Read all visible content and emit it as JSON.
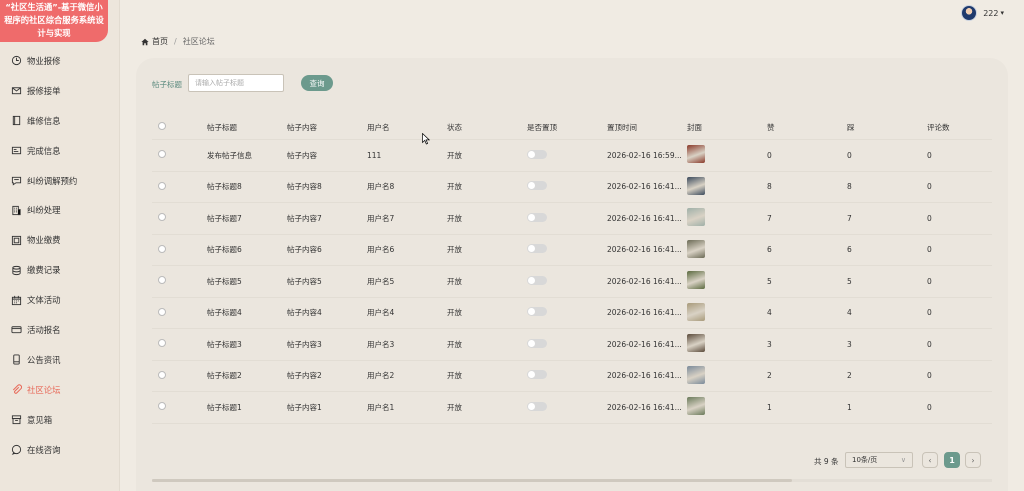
{
  "brand": {
    "title": "“社区生活通”-基于微信小程序的社区综合服务系统设计与实现"
  },
  "sidebar": {
    "items": [
      {
        "label": "物业报修",
        "icon": "clock-icon",
        "active": false
      },
      {
        "label": "报修接单",
        "icon": "mail-icon",
        "active": false
      },
      {
        "label": "维修信息",
        "icon": "book-icon",
        "active": false
      },
      {
        "label": "完成信息",
        "icon": "card-icon",
        "active": false
      },
      {
        "label": "纠纷调解预约",
        "icon": "chat-icon",
        "active": false
      },
      {
        "label": "纠纷处理",
        "icon": "building-icon",
        "active": false
      },
      {
        "label": "物业缴费",
        "icon": "grid-icon",
        "active": false
      },
      {
        "label": "缴费记录",
        "icon": "database-icon",
        "active": false
      },
      {
        "label": "文体活动",
        "icon": "calendar-icon",
        "active": false
      },
      {
        "label": "活动报名",
        "icon": "ticket-icon",
        "active": false
      },
      {
        "label": "公告资讯",
        "icon": "phone-icon",
        "active": false
      },
      {
        "label": "社区论坛",
        "icon": "paperclip-icon",
        "active": true
      },
      {
        "label": "意见箱",
        "icon": "box-icon",
        "active": false
      },
      {
        "label": "在线咨询",
        "icon": "bubble-icon",
        "active": false
      }
    ]
  },
  "header": {
    "username": "222"
  },
  "breadcrumb": {
    "home": "首页",
    "current": "社区论坛"
  },
  "search": {
    "label": "帖子标题",
    "placeholder": "请输入帖子标题",
    "button": "查询"
  },
  "table": {
    "columns": [
      "",
      "帖子标题",
      "帖子内容",
      "用户名",
      "状态",
      "是否置顶",
      "置顶时间",
      "封面",
      "赞",
      "踩",
      "评论数"
    ],
    "rows": [
      {
        "title": "发布帖子信息",
        "content": "帖子内容",
        "user": "111",
        "status": "开放",
        "top_time": "2026-02-16 16:59...",
        "like": "0",
        "dislike": "0",
        "comments": "0",
        "cover": "#8a3a2a"
      },
      {
        "title": "帖子标题8",
        "content": "帖子内容8",
        "user": "用户名8",
        "status": "开放",
        "top_time": "2026-02-16 16:41...",
        "like": "8",
        "dislike": "8",
        "comments": "0",
        "cover": "#3b4a5c"
      },
      {
        "title": "帖子标题7",
        "content": "帖子内容7",
        "user": "用户名7",
        "status": "开放",
        "top_time": "2026-02-16 16:41...",
        "like": "7",
        "dislike": "7",
        "comments": "0",
        "cover": "#9fb0a8"
      },
      {
        "title": "帖子标题6",
        "content": "帖子内容6",
        "user": "用户名6",
        "status": "开放",
        "top_time": "2026-02-16 16:41...",
        "like": "6",
        "dislike": "6",
        "comments": "0",
        "cover": "#6b6a55"
      },
      {
        "title": "帖子标题5",
        "content": "帖子内容5",
        "user": "用户名5",
        "status": "开放",
        "top_time": "2026-02-16 16:41...",
        "like": "5",
        "dislike": "5",
        "comments": "0",
        "cover": "#5b6a3f"
      },
      {
        "title": "帖子标题4",
        "content": "帖子内容4",
        "user": "用户名4",
        "status": "开放",
        "top_time": "2026-02-16 16:41...",
        "like": "4",
        "dislike": "4",
        "comments": "0",
        "cover": "#a89a7a"
      },
      {
        "title": "帖子标题3",
        "content": "帖子内容3",
        "user": "用户名3",
        "status": "开放",
        "top_time": "2026-02-16 16:41...",
        "like": "3",
        "dislike": "3",
        "comments": "0",
        "cover": "#5a4a3a"
      },
      {
        "title": "帖子标题2",
        "content": "帖子内容2",
        "user": "用户名2",
        "status": "开放",
        "top_time": "2026-02-16 16:41...",
        "like": "2",
        "dislike": "2",
        "comments": "0",
        "cover": "#7a8a9a"
      },
      {
        "title": "帖子标题1",
        "content": "帖子内容1",
        "user": "用户名1",
        "status": "开放",
        "top_time": "2026-02-16 16:41...",
        "like": "1",
        "dislike": "1",
        "comments": "0",
        "cover": "#6a7a5a"
      }
    ]
  },
  "pagination": {
    "total": "共 9 条",
    "page_size": "10条/页",
    "current_page": "1",
    "prev": "‹",
    "next": "›"
  },
  "colors": {
    "accent": "#6c9a8d",
    "brand": "#ef6b6b",
    "active_menu": "#e86a5a"
  }
}
